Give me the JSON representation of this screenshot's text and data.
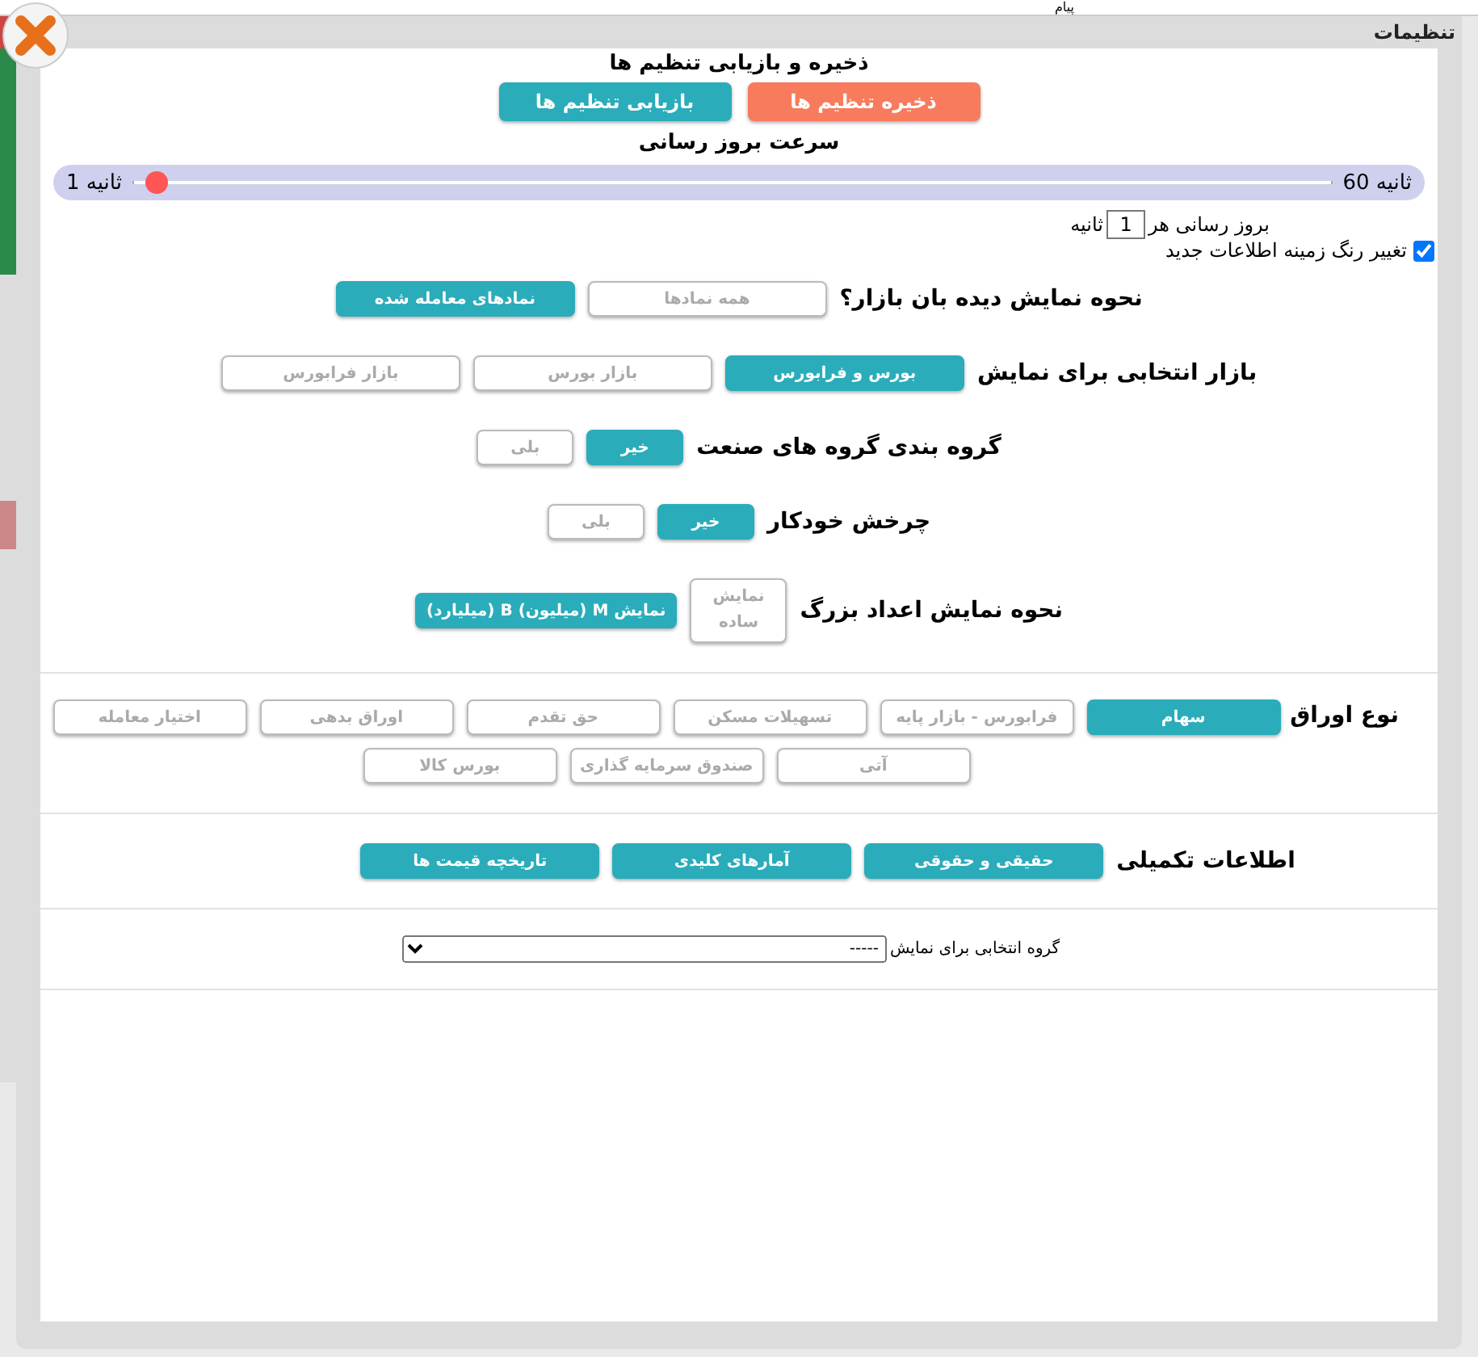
{
  "background": {
    "header_text": "پیام"
  },
  "window": {
    "title": "تنظیمات"
  },
  "save_restore": {
    "heading": "ذخیره و بازیابی تنظیم ها",
    "buttons": [
      {
        "label": "ذخیره تنظیم ها",
        "kind": "save"
      },
      {
        "label": "بازیابی تنظیم ها",
        "kind": "restore"
      }
    ]
  },
  "refresh_speed": {
    "heading": "سرعت بروز رسانی",
    "max_label": "ثانیه 60",
    "min_label": "ثانیه 1",
    "level": 0.02,
    "interval_prefix": "بروز رسانی هر",
    "interval_value": "1",
    "interval_suffix": "ثانیه"
  },
  "highlight_new": {
    "label": "تغییر رنگ زمینه اطلاعات جدید",
    "checked": true
  },
  "option_rows": [
    {
      "label": "نحوه نمایش دیده بان بازار؟",
      "options": [
        {
          "label": "همه نمادها",
          "selected": false
        },
        {
          "label": "نمادهای معامله شده",
          "selected": true
        }
      ]
    },
    {
      "label": "بازار انتخابی برای نمایش",
      "options": [
        {
          "label": "بورس و فرابورس",
          "selected": true
        },
        {
          "label": "بازار بورس",
          "selected": false
        },
        {
          "label": "بازار فرابورس",
          "selected": false
        }
      ]
    },
    {
      "label": "گروه بندی گروه های صنعت",
      "options": [
        {
          "label": "خیر",
          "selected": true
        },
        {
          "label": "بلی",
          "selected": false
        }
      ]
    },
    {
      "label": "چرخش خودکار",
      "options": [
        {
          "label": "خیر",
          "selected": true
        },
        {
          "label": "بلی",
          "selected": false
        }
      ]
    },
    {
      "label": "نحوه نمایش اعداد بزرگ",
      "options": [
        {
          "label": "نمایش ساده",
          "selected": false
        },
        {
          "label": "نمایش M (میلیون) B (میلیارد)",
          "selected": true
        }
      ]
    }
  ],
  "security_types": {
    "label": "نوع اوراق",
    "options": [
      {
        "label": "سهام",
        "selected": true
      },
      {
        "label": "فرابورس - بازار پایه",
        "selected": false
      },
      {
        "label": "تسهیلات مسکن",
        "selected": false
      },
      {
        "label": "حق تقدم",
        "selected": false
      },
      {
        "label": "اوراق بدهی",
        "selected": false
      },
      {
        "label": "اختیار معامله",
        "selected": false
      },
      {
        "label": "آتی",
        "selected": false
      },
      {
        "label": "صندوق سرمایه گذاری",
        "selected": false
      },
      {
        "label": "بورس کالا",
        "selected": false
      }
    ]
  },
  "extra_info": {
    "label": "اطلاعات تکمیلی",
    "options": [
      {
        "label": "حقیقی و حقوقی",
        "selected": true
      },
      {
        "label": "آمارهای کلیدی",
        "selected": true
      },
      {
        "label": "تاریخچه قیمت ها",
        "selected": true
      }
    ]
  },
  "group_select": {
    "label": "گروه انتخابی برای نمایش",
    "value": "-----"
  }
}
